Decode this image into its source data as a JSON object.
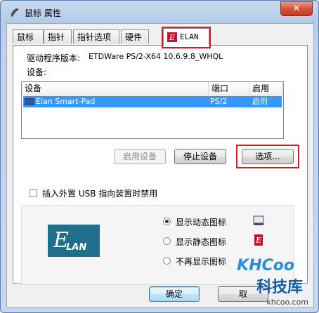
{
  "window": {
    "title": "鼠标 属性",
    "close_symbol": "✕"
  },
  "tabs": [
    {
      "label": "鼠标键"
    },
    {
      "label": "指针"
    },
    {
      "label": "指针选项"
    },
    {
      "label": "硬件"
    },
    {
      "label": "ELAN",
      "active": true
    }
  ],
  "driver": {
    "label": "驱动程序版本:",
    "value": "ETDWare PS/2-X64 10.6.9.8_WHQL"
  },
  "devices": {
    "section_label": "设备:",
    "columns": [
      "设备",
      "端口",
      "启用"
    ],
    "rows": [
      {
        "device": "Elan Smart-Pad",
        "port": "PS/2",
        "enabled": "启用"
      }
    ]
  },
  "buttons": {
    "enable_device": "启用设备",
    "stop_device": "停止设备",
    "options": "选项...",
    "ok": "确定",
    "cancel": "取"
  },
  "usb_disable": {
    "label": "插入外置 USB 指向装置时禁用",
    "checked": false
  },
  "tray_icon": {
    "options": [
      {
        "label": "显示动态图标",
        "checked": true
      },
      {
        "label": "显示静态图标",
        "checked": false
      },
      {
        "label": "不再显示图标",
        "checked": false
      }
    ]
  },
  "watermark": {
    "brand": "KHCoo",
    "cn": "科技库",
    "url": "khcoo.com"
  },
  "colors": {
    "highlight_red": "#d21f27",
    "selection_blue": "#3399ff",
    "elan_teal": "#1f6f8b"
  }
}
